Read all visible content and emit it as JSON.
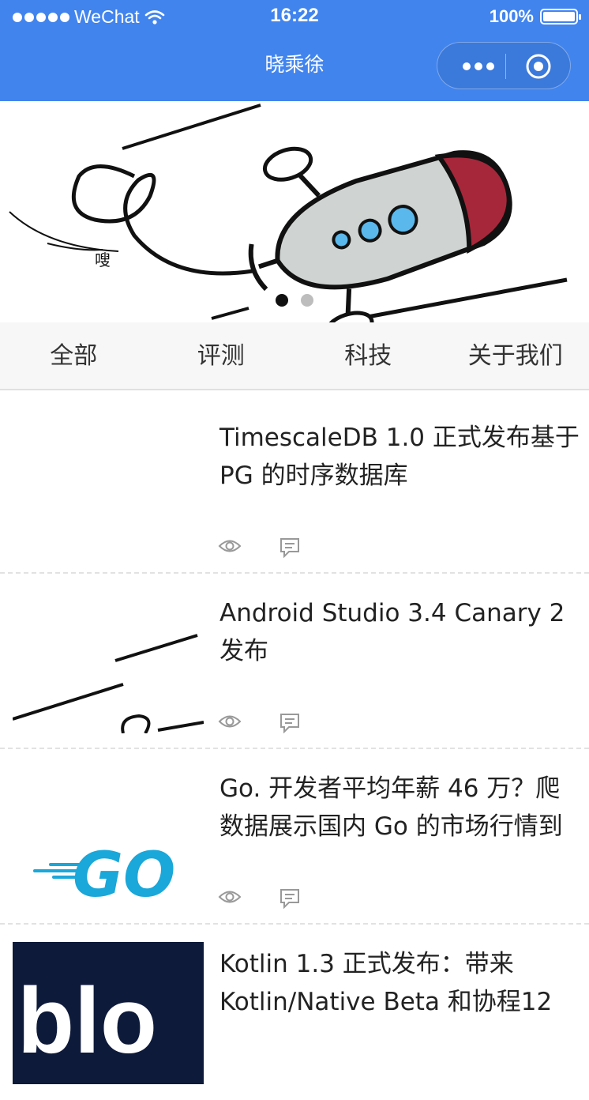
{
  "status_bar": {
    "carrier": "WeChat",
    "time": "16:22",
    "battery": "100%"
  },
  "nav": {
    "title": "晓乘徐"
  },
  "banner": {
    "caption": "嗖",
    "active_slide_color": "#111111",
    "inactive_slide_color": "#bdbdbd"
  },
  "tabs": [
    {
      "label": "全部"
    },
    {
      "label": "评测"
    },
    {
      "label": "科技"
    },
    {
      "label": "关于我们"
    }
  ],
  "articles": [
    {
      "title": "TimescaleDB 1.0 正式发布基于PG 的时序数据库"
    },
    {
      "title": "Android Studio 3.4 Canary 2 发布"
    },
    {
      "title": "Go. 开发者平均年薪 46 万？爬数据展示国内 Go 的市场行情到"
    },
    {
      "title": "Kotlin 1.3 正式发布：带来Kotlin/Native Beta 和协程12",
      "thumb_text": "blo"
    }
  ],
  "go_logo_text": "GO",
  "colors": {
    "primary": "#4184ee",
    "go_blue": "#1aa7d9",
    "rocket_red": "#a7273a",
    "blog_navy": "#0e1a3a"
  }
}
